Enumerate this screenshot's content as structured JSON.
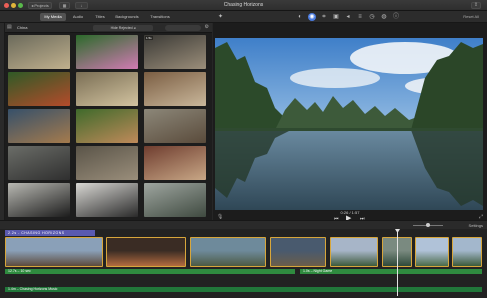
{
  "window": {
    "title": "Chasing Horizons",
    "projects_label": "◂ Projects",
    "share_icon": "share-icon"
  },
  "toolbar": {
    "tabs": [
      "My Media",
      "Audio",
      "Titles",
      "Backgrounds",
      "Transitions"
    ],
    "active_tab": "My Media",
    "reset_label": "Reset All",
    "adjust_icons": [
      "color-balance-icon",
      "color-correction-icon",
      "crop-icon",
      "stabilization-icon",
      "volume-icon",
      "noise-reduction-icon",
      "speed-icon",
      "filter-icon",
      "info-icon"
    ]
  },
  "browser": {
    "title": "China",
    "filter": "Hide Rejected ◂",
    "thumbnails": [
      {
        "duration": "",
        "colors": [
          "#6b6a5b",
          "#c0b08d"
        ]
      },
      {
        "duration": "",
        "colors": [
          "#2b6a2a",
          "#d27bb4"
        ]
      },
      {
        "duration": "1.5s",
        "colors": [
          "#3b3a36",
          "#9b8e7a"
        ]
      },
      {
        "duration": "",
        "colors": [
          "#2f5a26",
          "#b54b2b"
        ]
      },
      {
        "duration": "",
        "colors": [
          "#7a6e54",
          "#d2c3a0"
        ]
      },
      {
        "duration": "",
        "colors": [
          "#7b5e43",
          "#c9b79b"
        ]
      },
      {
        "duration": "",
        "colors": [
          "#36506a",
          "#a57b4d"
        ]
      },
      {
        "duration": "",
        "colors": [
          "#3f6a2b",
          "#c08a5a"
        ]
      },
      {
        "duration": "",
        "colors": [
          "#8c8779",
          "#5a4b3b"
        ]
      },
      {
        "duration": "",
        "colors": [
          "#6b6d68",
          "#2f2f2f"
        ]
      },
      {
        "duration": "",
        "colors": [
          "#5a5448",
          "#9a8e7b"
        ]
      },
      {
        "duration": "",
        "colors": [
          "#6f3d2f",
          "#c8a786"
        ]
      },
      {
        "duration": "",
        "colors": [
          "#b9b9b3",
          "#1c1c1c"
        ]
      },
      {
        "duration": "",
        "colors": [
          "#d9d8d4",
          "#2a2a2a"
        ]
      },
      {
        "duration": "",
        "colors": [
          "#9fa6a0",
          "#3f4a40"
        ]
      }
    ]
  },
  "viewer": {
    "timecode": "0:26 / 1:57"
  },
  "timeline": {
    "settings_label": "Settings",
    "zoom_level": 0.45,
    "project_title": "2.2s - CHASING HORIZONS",
    "clips": [
      {
        "colors": [
          "#8aa0b8",
          "#5c4a3c"
        ]
      },
      {
        "colors": [
          "#3a2c24",
          "#b36b3f"
        ]
      },
      {
        "colors": [
          "#6e8a9b",
          "#4c5a44"
        ]
      },
      {
        "colors": [
          "#495a6e",
          "#6b5d4a"
        ]
      },
      {
        "colors": [
          "#a7b5c8",
          "#3d5a3b"
        ]
      },
      {
        "colors": [
          "#7a8a80",
          "#2f4a3a"
        ]
      },
      {
        "colors": [
          "#b0c2d8",
          "#4a6a48"
        ]
      },
      {
        "colors": [
          "#a3b7cc",
          "#3b5a3a"
        ]
      }
    ],
    "audio_tracks": [
      {
        "label": "12.7s – 10 sec",
        "kind": "clip-audio"
      },
      {
        "label": "1.0s – Night Game",
        "kind": "clip-audio"
      },
      {
        "label": "1.4m – Chasing Horizons Music",
        "kind": "music"
      }
    ]
  },
  "colors": {
    "accent_tab": "#525252",
    "clip_border": "#d7a63b",
    "audio_green": "#2f8b3f",
    "title_purple": "#5a5ab0"
  }
}
